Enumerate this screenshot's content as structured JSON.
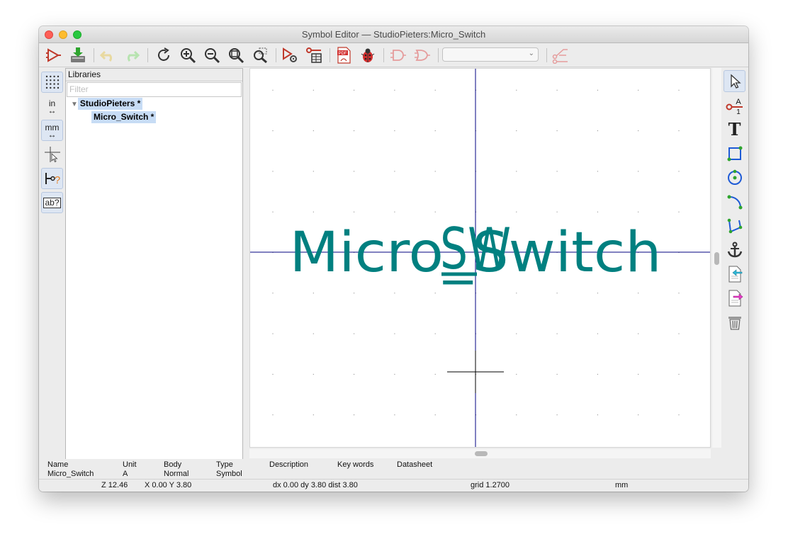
{
  "window": {
    "title": "Symbol Editor — StudioPieters:Micro_Switch"
  },
  "toolbar": {
    "icons": [
      "new-symbol-icon",
      "save-icon",
      "undo-icon",
      "redo-icon",
      "refresh-icon",
      "zoom-in-icon",
      "zoom-out-icon",
      "zoom-fit-icon",
      "zoom-selection-icon",
      "symbol-properties-icon",
      "pin-table-icon",
      "export-pdf-icon",
      "check-symbol-icon",
      "show-de-morgan-standard-icon",
      "show-de-morgan-alternate-icon",
      "unit-select-dropdown",
      "show-datasheet-icon"
    ],
    "pdf_label": "PDF",
    "unit_dropdown_value": ""
  },
  "left_tools": {
    "grid": "grid-icon",
    "inches_label": "in",
    "mm_label": "mm",
    "cursor": "full-crosshair-cursor-icon",
    "pin_type": "pin-electrical-type-icon",
    "text_label": "ab?"
  },
  "libraries": {
    "header": "Libraries",
    "filter_placeholder": "Filter",
    "library_name": "StudioPieters *",
    "symbol_name": "Micro_Switch *"
  },
  "canvas": {
    "value_text": "Micro_Switch",
    "reference_text": "SW",
    "text_color": "#008080",
    "axis_color": "#000080"
  },
  "right_tools": {
    "icons": [
      "select-arrow-icon",
      "add-pin-icon",
      "add-text-icon",
      "add-rectangle-icon",
      "add-circle-icon",
      "add-arc-icon",
      "add-polyline-icon",
      "anchor-icon",
      "import-graphics-icon",
      "export-graphics-icon",
      "delete-icon"
    ],
    "text_glyph": "T",
    "pin_label_a": "A",
    "pin_label_1": "1"
  },
  "message_panel": {
    "headers": [
      "Name",
      "Unit",
      "Body",
      "Type",
      "Description",
      "Key words",
      "Datasheet"
    ],
    "values": [
      "Micro_Switch",
      "A",
      "Normal",
      "Symbol",
      "",
      "",
      ""
    ]
  },
  "status_bar": {
    "zoom": "Z 12.46",
    "position": "X 0.00  Y 3.80",
    "delta": "dx 0.00  dy 3.80  dist 3.80",
    "grid": "grid 1.2700",
    "units": "mm"
  }
}
